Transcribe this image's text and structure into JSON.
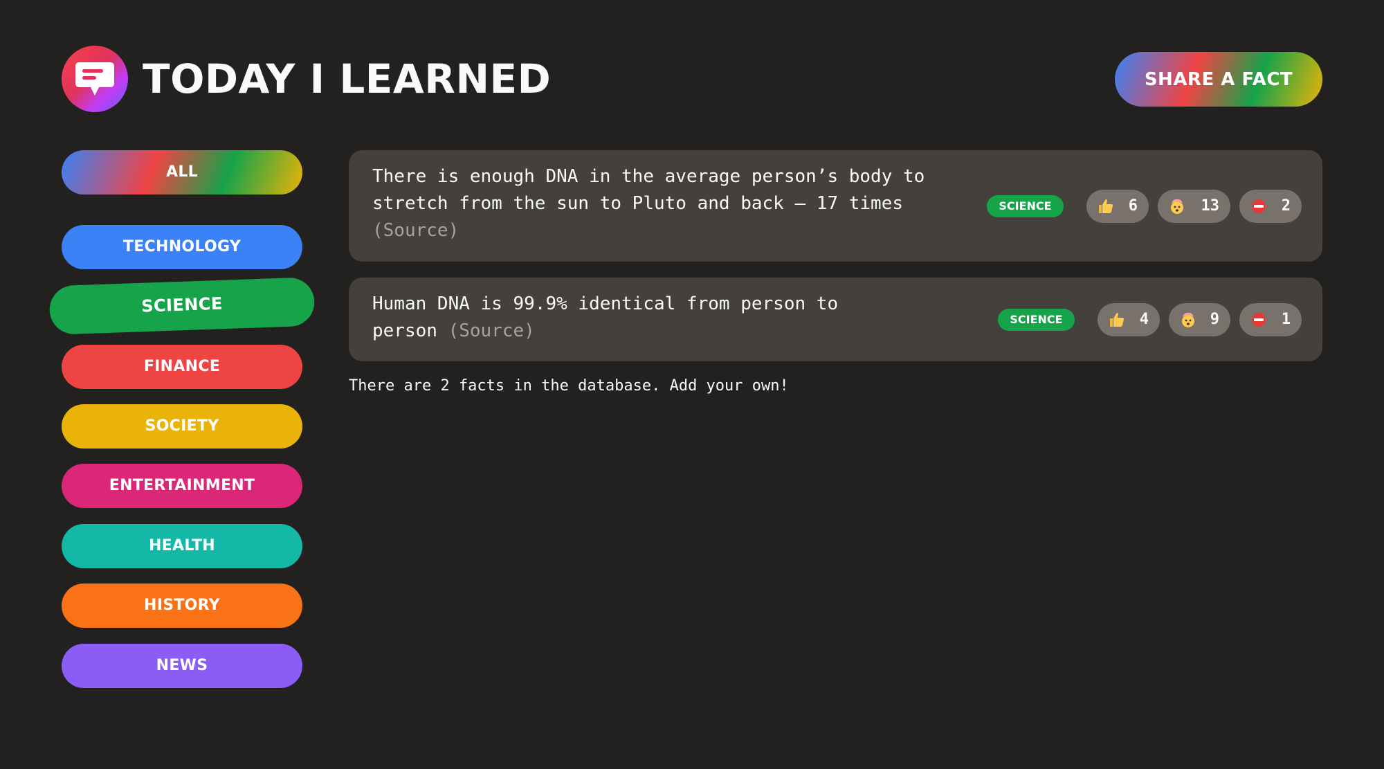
{
  "header": {
    "title": "TODAY I LEARNED",
    "logo_icon": "speech-bubble-icon",
    "share_button": "SHARE A FACT"
  },
  "colors": {
    "background": "#232020",
    "card": "#44403c",
    "vote": "#78716c",
    "technology": "#3b82f6",
    "science": "#16a34a",
    "finance": "#ef4444",
    "society": "#eab308",
    "entertainment": "#db2777",
    "health": "#14b8a6",
    "history": "#f97316",
    "news": "#8b5cf6"
  },
  "sidebar": {
    "categories": [
      {
        "label": "ALL"
      },
      {
        "label": "TECHNOLOGY"
      },
      {
        "label": "SCIENCE"
      },
      {
        "label": "FINANCE"
      },
      {
        "label": "SOCIETY"
      },
      {
        "label": "ENTERTAINMENT"
      },
      {
        "label": "HEALTH"
      },
      {
        "label": "HISTORY"
      },
      {
        "label": "NEWS"
      }
    ]
  },
  "facts": [
    {
      "text": "There is enough DNA in the average person’s body to stretch from the sun to Pluto and back — 17 times",
      "source": "(Source)",
      "category": "SCIENCE",
      "votes": [
        {
          "icon": "thumbs-up-icon",
          "count": "6"
        },
        {
          "icon": "mind-blown-icon",
          "count": "13"
        },
        {
          "icon": "no-entry-icon",
          "count": "2"
        }
      ]
    },
    {
      "text": "Human DNA is 99.9% identical from person to person",
      "source": "(Source)",
      "category": "SCIENCE",
      "votes": [
        {
          "icon": "thumbs-up-icon",
          "count": "4"
        },
        {
          "icon": "mind-blown-icon",
          "count": "9"
        },
        {
          "icon": "no-entry-icon",
          "count": "1"
        }
      ]
    }
  ],
  "footer": {
    "text": "There are 2 facts in the database. Add your own!"
  }
}
